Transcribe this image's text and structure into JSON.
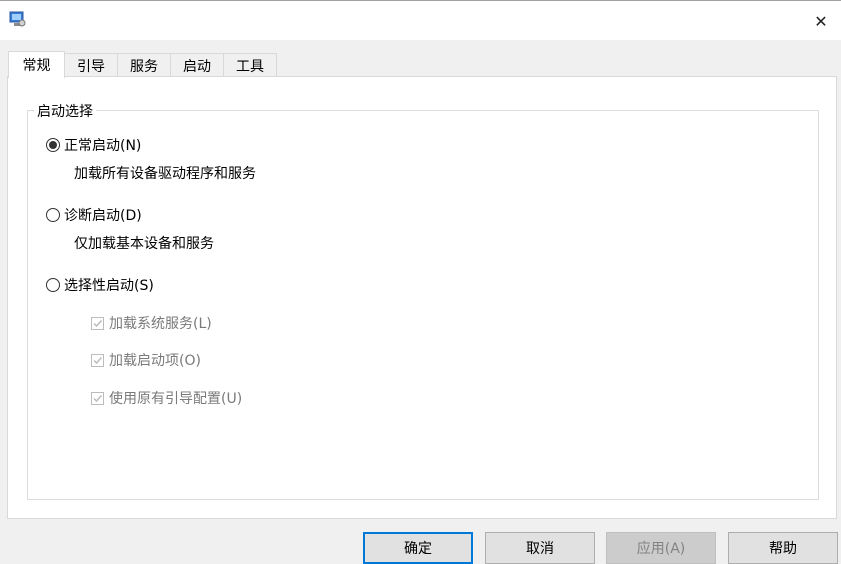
{
  "window": {
    "close_glyph": "✕"
  },
  "tabs": [
    {
      "label": "常规",
      "active": true
    },
    {
      "label": "引导",
      "active": false
    },
    {
      "label": "服务",
      "active": false
    },
    {
      "label": "启动",
      "active": false
    },
    {
      "label": "工具",
      "active": false
    }
  ],
  "startup_selection": {
    "legend": "启动选择",
    "options": [
      {
        "label": "正常启动(N)",
        "description": "加载所有设备驱动程序和服务",
        "selected": true
      },
      {
        "label": "诊断启动(D)",
        "description": "仅加载基本设备和服务",
        "selected": false
      },
      {
        "label": "选择性启动(S)",
        "selected": false
      }
    ],
    "selective_items": [
      {
        "label": "加载系统服务(L)",
        "checked": true,
        "enabled": false
      },
      {
        "label": "加载启动项(O)",
        "checked": true,
        "enabled": false
      },
      {
        "label": "使用原有引导配置(U)",
        "checked": true,
        "enabled": false
      }
    ]
  },
  "buttons": {
    "ok": "确定",
    "cancel": "取消",
    "apply": "应用(A)",
    "help": "帮助"
  },
  "colors": {
    "accent": "#0078d7",
    "disabled_text": "#7a7a7a"
  }
}
